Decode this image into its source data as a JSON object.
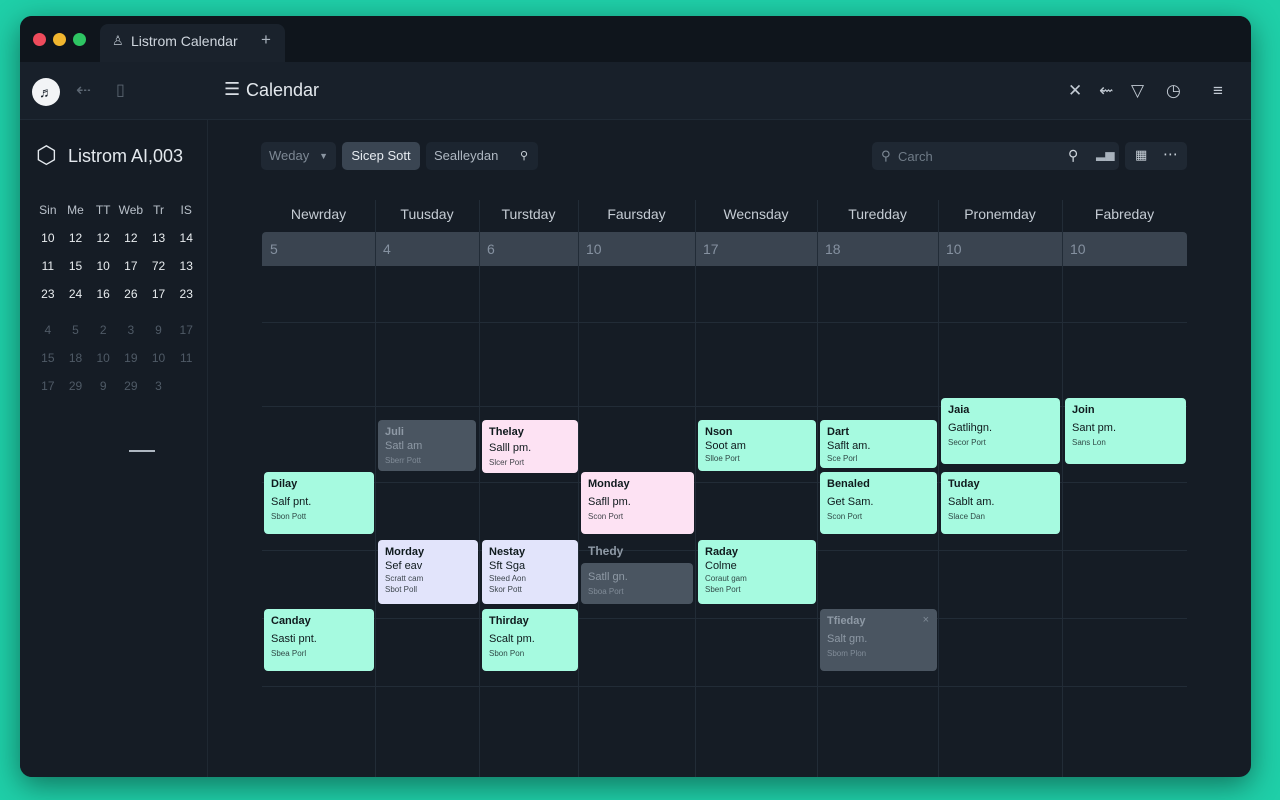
{
  "window": {
    "tab_title": "Listrom Calendar",
    "tab_icon": "person-icon",
    "tab_add": "+"
  },
  "toolbar": {
    "app_logo_glyph": "♬",
    "menu_glyph": "☰",
    "title": "Calendar",
    "right_icons": [
      "close-icon",
      "reply-icon",
      "inbox-icon",
      "clock-icon",
      "hamburger-icon"
    ]
  },
  "sidebar": {
    "brand": "Listrom AI,003",
    "mini_calendar": {
      "weekday_headers": [
        "Sin",
        "Me",
        "TT",
        "Web",
        "Tr",
        "IS"
      ],
      "weeks": [
        [
          "10",
          "12",
          "12",
          "12",
          "13",
          "14"
        ],
        [
          "11",
          "15",
          "10",
          "17",
          "72",
          "13"
        ],
        [
          "23",
          "24",
          "16",
          "26",
          "17",
          "23"
        ]
      ],
      "dim_weeks": [
        [
          "4",
          "5",
          "2",
          "3",
          "9",
          "17"
        ],
        [
          "15",
          "18",
          "10",
          "19",
          "10",
          "11"
        ],
        [
          "17",
          "29",
          "9",
          "29",
          "3",
          ""
        ]
      ],
      "selected": "29"
    }
  },
  "filters": {
    "view_label": "Weday",
    "sort_label": "Sicep Sott",
    "select_label": "Sealleydan"
  },
  "search": {
    "placeholder": "Carch"
  },
  "calendar": {
    "days": [
      {
        "name": "Newrday",
        "date": "5"
      },
      {
        "name": "Tuusday",
        "date": "4"
      },
      {
        "name": "Turstday",
        "date": "6"
      },
      {
        "name": "Faursday",
        "date": "10"
      },
      {
        "name": "Wecnsday",
        "date": "17"
      },
      {
        "name": "Turedday",
        "date": "18"
      },
      {
        "name": "Pronemday",
        "date": "10"
      },
      {
        "name": "Fabreday",
        "date": "10"
      }
    ],
    "events": [
      {
        "title": "Juli",
        "time": "Satl am",
        "location": "Sberr Pott",
        "color": "gray"
      },
      {
        "title": "Thelay",
        "time": "Salll pm.",
        "location": "Slcer Port",
        "color": "pink"
      },
      {
        "title": "Nson",
        "time": "Soot am",
        "location": "Slloe Port",
        "color": "mint"
      },
      {
        "title": "Dart",
        "time": "Saflt am.",
        "location": "Sce Porl",
        "color": "mint"
      },
      {
        "title": "Jaia",
        "time": "Gatlihgn.",
        "location": "Secor Port",
        "color": "mint"
      },
      {
        "title": "Join",
        "time": "Sant pm.",
        "location": "Sans Lon",
        "color": "mint"
      },
      {
        "title": "Dilay",
        "time": "Salf pnt.",
        "location": "Sbon Pott",
        "color": "mint"
      },
      {
        "title": "Monday",
        "time": "Safll pm.",
        "location": "Scon Port",
        "color": "pink"
      },
      {
        "title": "Benaled",
        "time": "Get Sam.",
        "location": "Scon Port",
        "color": "mint"
      },
      {
        "title": "Tuday",
        "time": "Sablt am.",
        "location": "Slace Dan",
        "color": "mint"
      },
      {
        "title": "Morday",
        "time": "Sef eav",
        "location": "Sbot Poll",
        "color": "lavender",
        "extra": "Scratt cam"
      },
      {
        "title": "Nestay",
        "time": "Sft Sga",
        "location": "Skor Pott",
        "color": "lavender",
        "extra": "Steed Aon"
      },
      {
        "title": "Thedy",
        "time": "Satll gn.",
        "location": "Sboa Port",
        "color": "gray"
      },
      {
        "title": "Raday",
        "time": "Colme",
        "location": "Sben Port",
        "color": "mint",
        "extra": "Coraut gam"
      },
      {
        "title": "Canday",
        "time": "Sasti pnt.",
        "location": "Sbea Porl",
        "color": "mint"
      },
      {
        "title": "Thirday",
        "time": "Scalt pm.",
        "location": "Sbon Pon",
        "color": "mint"
      },
      {
        "title": "Tfieday",
        "time": "Salt gm.",
        "location": "Sbom Plon",
        "color": "gray",
        "close": "×"
      }
    ]
  },
  "colors": {
    "background": "#1fcfa8",
    "window": "#151c25",
    "mint": "#a6fae0",
    "pink": "#fde2f3",
    "lavender": "#e2e4fb",
    "gray": "#4a5561"
  }
}
